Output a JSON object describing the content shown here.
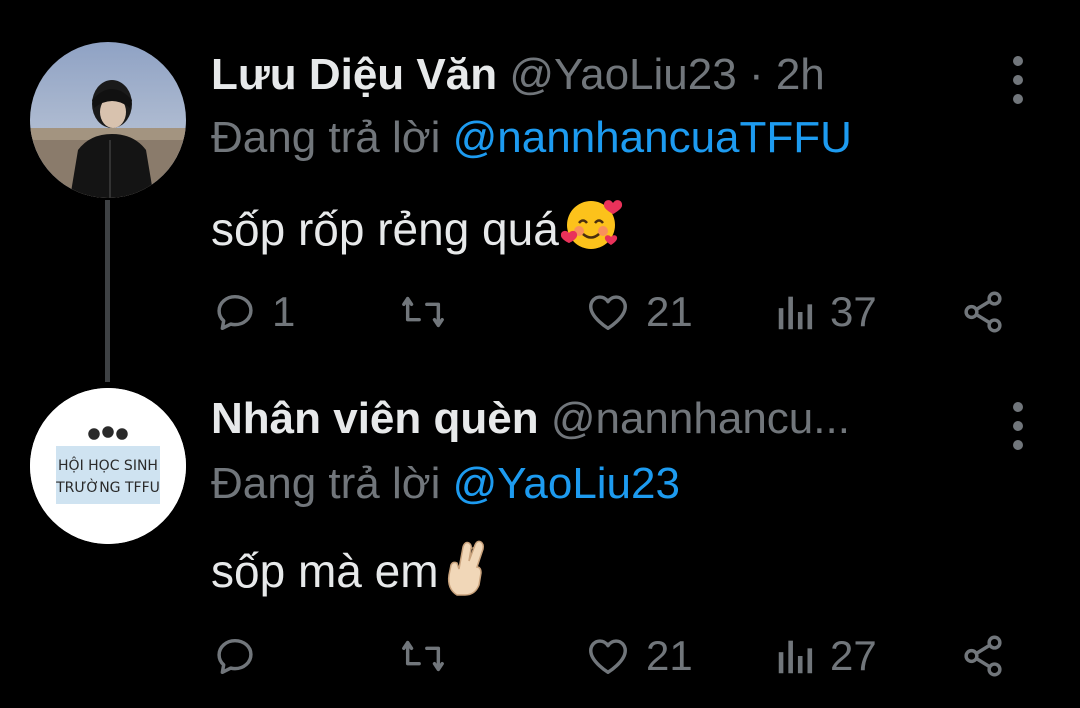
{
  "tweets": [
    {
      "display_name": "Lưu Diệu Văn",
      "handle": "@YaoLiu23",
      "separator": "·",
      "time": "2h",
      "reply_prefix": "Đang trả lời",
      "reply_to": "@nannhancuaTFFU",
      "text": "sốp rốp rẻng quá",
      "emoji": "smiling-face-with-hearts",
      "replies": "1",
      "retweets": "",
      "likes": "21",
      "views": "37"
    },
    {
      "display_name": "Nhân viên quèn",
      "handle": "@nannhancu...",
      "separator": "",
      "time": "",
      "reply_prefix": "Đang trả lời",
      "reply_to": "@YaoLiu23",
      "text": "sốp mà em",
      "emoji": "crossed-fingers",
      "replies": "",
      "retweets": "",
      "likes": "21",
      "views": "27",
      "avatar_text": [
        "HỘI HỌC SINH",
        "TRƯỜNG TFFU"
      ]
    }
  ],
  "colors": {
    "background": "#000000",
    "primary_text": "#e7e9ea",
    "secondary_text": "#71767b",
    "accent": "#1d9bf0"
  },
  "icons": [
    "reply-icon",
    "retweet-icon",
    "like-icon",
    "views-icon",
    "share-icon",
    "more-icon"
  ]
}
